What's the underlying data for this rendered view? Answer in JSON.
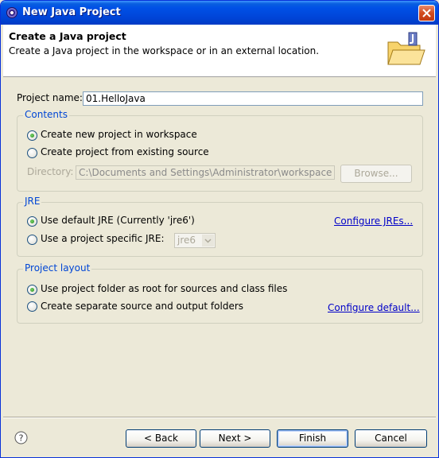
{
  "window": {
    "title": "New Java Project",
    "close_icon": "close-icon"
  },
  "banner": {
    "title": "Create a Java project",
    "description": "Create a Java project in the workspace or in an external location.",
    "icon": "java-project-folder-icon"
  },
  "project_name": {
    "label": "Project name:",
    "value": "01.HelloJava"
  },
  "contents": {
    "legend": "Contents",
    "option_new": "Create new project in workspace",
    "option_existing": "Create project from existing source",
    "selected": "new",
    "directory_label": "Directory:",
    "directory_value": "C:\\Documents and Settings\\Administrator\\workspace",
    "browse_label": "Browse..."
  },
  "jre": {
    "legend": "JRE",
    "option_default": "Use default JRE (Currently 'jre6')",
    "option_specific": "Use a project specific JRE:",
    "selected": "default",
    "specific_value": "jre6",
    "configure_link": "Configure JREs..."
  },
  "project_layout": {
    "legend": "Project layout",
    "option_root": "Use project folder as root for sources and class files",
    "option_separate": "Create separate source and output folders",
    "selected": "root",
    "configure_link": "Configure default..."
  },
  "footer": {
    "help_icon": "help-icon",
    "back_label": "< Back",
    "next_label": "Next >",
    "finish_label": "Finish",
    "cancel_label": "Cancel"
  },
  "colors": {
    "titlebar": "#0050e6",
    "group_legend": "#0046d5",
    "link": "#0000c8",
    "dialog_bg": "#ece9d8"
  }
}
